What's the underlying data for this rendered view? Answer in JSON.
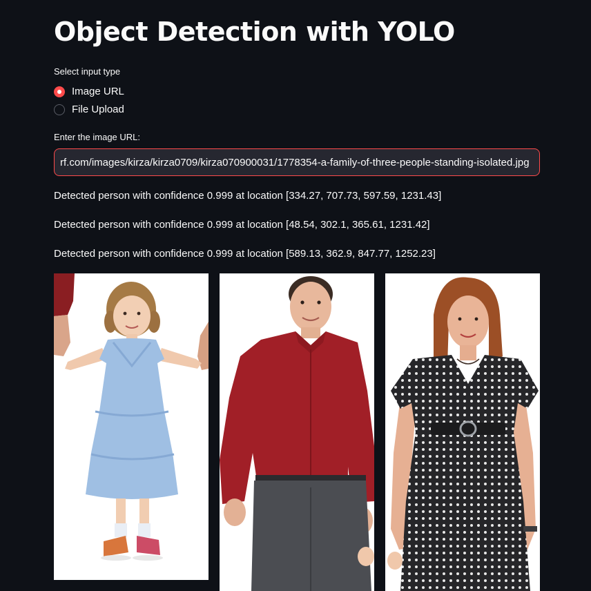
{
  "page": {
    "title": "Object Detection with YOLO"
  },
  "input_type": {
    "label": "Select input type",
    "options": [
      "Image URL",
      "File Upload"
    ],
    "selected": "Image URL"
  },
  "url_field": {
    "label": "Enter the image URL:",
    "value": "rf.com/images/kirza/kirza0709/kirza070900031/1778354-a-family-of-three-people-standing-isolated.jpg"
  },
  "detections": [
    "Detected person with confidence 0.999 at location [334.27, 707.73, 597.59, 1231.43]",
    "Detected person with confidence 0.999 at location [48.54, 302.1, 365.61, 1231.42]",
    "Detected person with confidence 0.999 at location [589.13, 362.9, 847.77, 1252.23]"
  ],
  "crops": [
    {
      "subject": "girl-in-blue-dress"
    },
    {
      "subject": "man-in-red-shirt"
    },
    {
      "subject": "woman-in-polka-dot-dress"
    }
  ],
  "colors": {
    "background": "#0e1117",
    "accent": "#ff4b4b",
    "input_bg": "#262730",
    "text": "#fafafa"
  }
}
